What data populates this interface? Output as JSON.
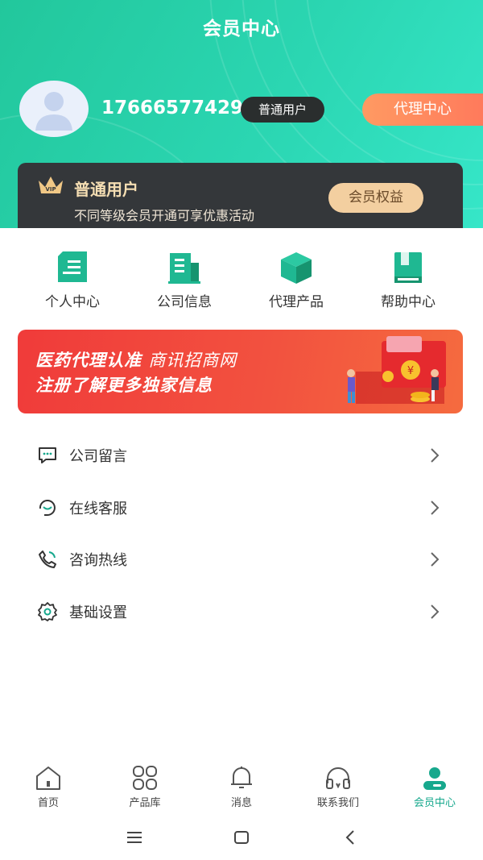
{
  "header": {
    "title": "会员中心"
  },
  "profile": {
    "phone": "17666577429",
    "level": "普通用户",
    "agent_button": "代理中心"
  },
  "vip_card": {
    "title": "普通用户",
    "description": "不同等级会员开通可享优惠活动",
    "benefit_button": "会员权益"
  },
  "shortcuts": [
    {
      "label": "个人中心",
      "icon": "document-icon"
    },
    {
      "label": "公司信息",
      "icon": "building-icon"
    },
    {
      "label": "代理产品",
      "icon": "box-icon"
    },
    {
      "label": "帮助中心",
      "icon": "book-icon"
    }
  ],
  "banner": {
    "line1_bold": "医药代理认准",
    "line1_light": "商讯招商网",
    "line2": "注册了解更多独家信息"
  },
  "menu": [
    {
      "label": "公司留言",
      "icon": "message-icon"
    },
    {
      "label": "在线客服",
      "icon": "headset-chat-icon"
    },
    {
      "label": "咨询热线",
      "icon": "phone-icon"
    },
    {
      "label": "基础设置",
      "icon": "gear-icon"
    }
  ],
  "tabbar": [
    {
      "label": "首页",
      "icon": "home-icon"
    },
    {
      "label": "产品库",
      "icon": "grid-icon"
    },
    {
      "label": "消息",
      "icon": "bell-icon"
    },
    {
      "label": "联系我们",
      "icon": "headphones-icon"
    },
    {
      "label": "会员中心",
      "icon": "user-icon",
      "active": true
    }
  ],
  "colors": {
    "brand_green": "#22c79c",
    "accent_orange": "#ff8a5e",
    "active_tab": "#17a88d"
  }
}
